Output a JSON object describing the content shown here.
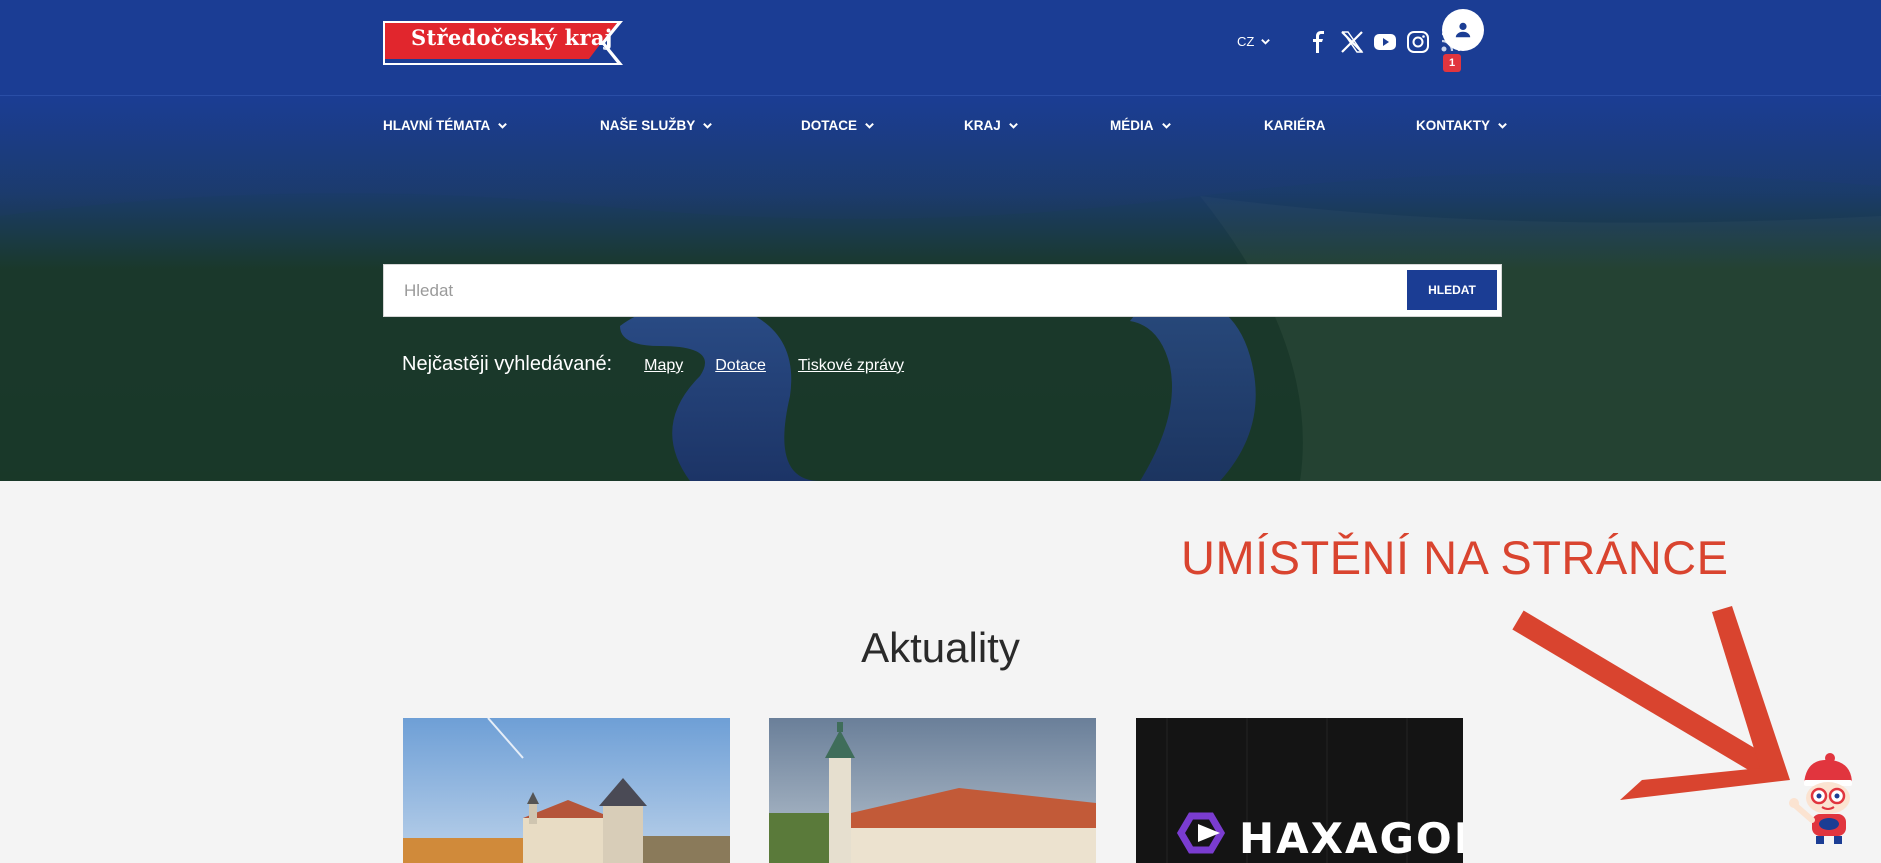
{
  "brand": {
    "logo_text": "Středočeský kraj"
  },
  "header": {
    "language": "CZ",
    "social": [
      "facebook-icon",
      "x-twitter-icon",
      "youtube-icon",
      "instagram-icon",
      "rss-icon"
    ],
    "notification_count": "1"
  },
  "nav": {
    "items": [
      {
        "label": "HLAVNÍ TÉMATA",
        "dropdown": true
      },
      {
        "label": "NAŠE SLUŽBY",
        "dropdown": true
      },
      {
        "label": "DOTACE",
        "dropdown": true
      },
      {
        "label": "KRAJ",
        "dropdown": true
      },
      {
        "label": "MÉDIA",
        "dropdown": true
      },
      {
        "label": "KARIÉRA",
        "dropdown": false
      },
      {
        "label": "KONTAKTY",
        "dropdown": true
      }
    ]
  },
  "search": {
    "placeholder": "Hledat",
    "button_label": "HLEDAT"
  },
  "popular": {
    "label": "Nejčastěji vyhledávané:",
    "links": [
      "Mapy",
      "Dotace",
      "Tiskové zprávy"
    ]
  },
  "annotation": {
    "text": "UMÍSTĚNÍ NA STRÁNCE"
  },
  "news": {
    "title": "Aktuality",
    "cards": [
      {
        "image": "kutna-hora-photo"
      },
      {
        "image": "chateau-tower-photo"
      },
      {
        "image": "haxagon-logo",
        "label": "HAXAGON"
      }
    ]
  },
  "colors": {
    "primary": "#1b3d94",
    "accent_red": "#e1353e",
    "annotation": "#d9442f",
    "background": "#f4f4f4"
  }
}
